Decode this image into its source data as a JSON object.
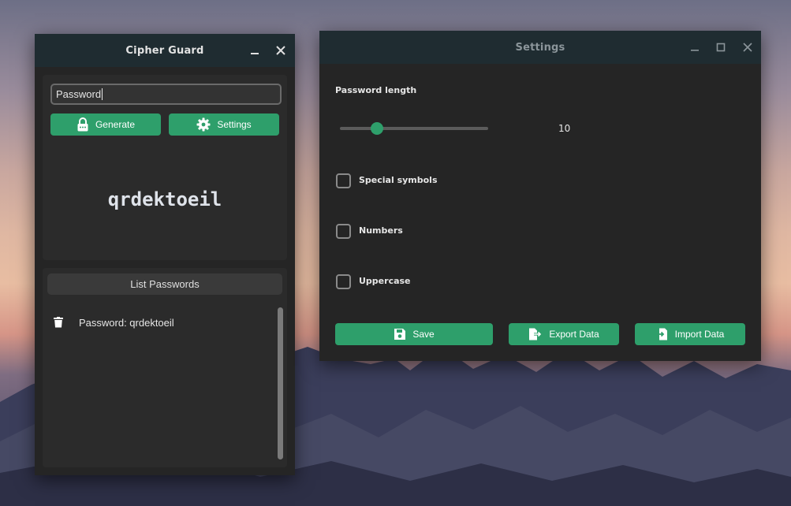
{
  "cipher_guard": {
    "title": "Cipher Guard",
    "input_value": "Password",
    "generate_label": "Generate",
    "settings_label": "Settings",
    "generated_password": "qrdektoeil",
    "list_title": "List Passwords",
    "list_items": [
      {
        "text": "Password: qrdektoeil",
        "icon": "trash-icon"
      }
    ]
  },
  "settings": {
    "title": "Settings",
    "password_length_label": "Password length",
    "password_length_value": "10",
    "special_symbols_label": "Special symbols",
    "special_symbols_checked": false,
    "numbers_label": "Numbers",
    "numbers_checked": false,
    "uppercase_label": "Uppercase",
    "uppercase_checked": false,
    "save_label": "Save",
    "export_label": "Export Data",
    "import_label": "Import Data"
  },
  "colors": {
    "accent": "#2e9f6b",
    "window_bg": "#252525",
    "titlebar_bg": "#1f2c31"
  }
}
